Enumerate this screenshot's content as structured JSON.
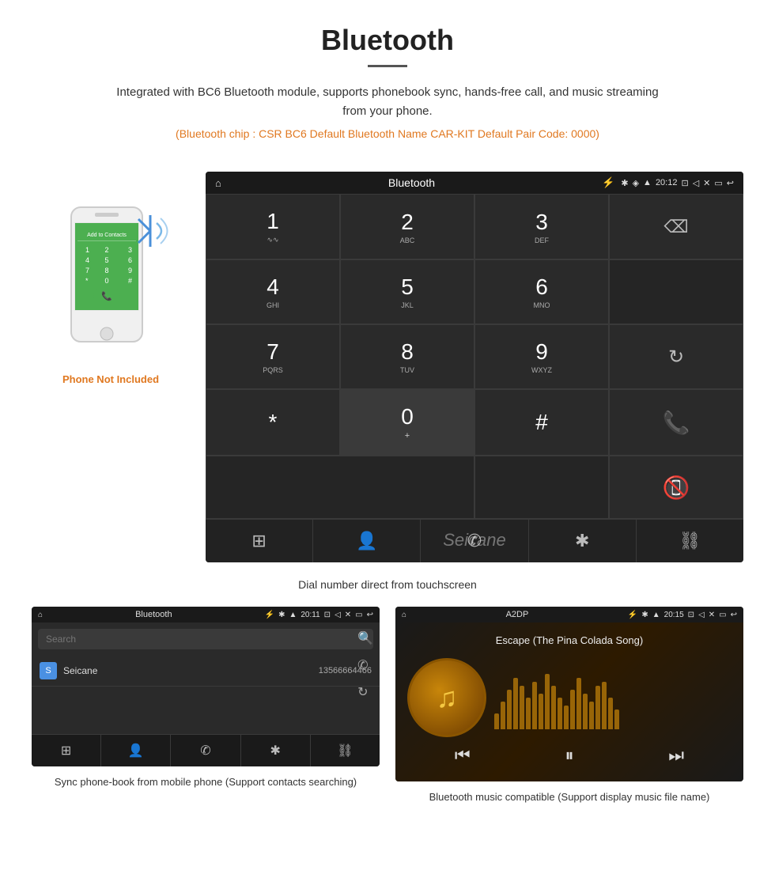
{
  "header": {
    "title": "Bluetooth",
    "description": "Integrated with BC6 Bluetooth module, supports phonebook sync, hands-free call, and music streaming from your phone.",
    "specs": "(Bluetooth chip : CSR BC6    Default Bluetooth Name CAR-KIT    Default Pair Code: 0000)"
  },
  "main_screen": {
    "status_bar": {
      "home_icon": "⌂",
      "title": "Bluetooth",
      "usb_icon": "⚡",
      "bt_icon": "✱",
      "location_icon": "◈",
      "signal_icon": "▲",
      "time": "20:12",
      "camera_icon": "⊡",
      "volume_icon": "◁",
      "close_icon": "✕",
      "window_icon": "▭",
      "back_icon": "↩"
    },
    "dialpad": [
      {
        "digit": "1",
        "sub": "∿∿",
        "type": "normal"
      },
      {
        "digit": "2",
        "sub": "ABC",
        "type": "normal"
      },
      {
        "digit": "3",
        "sub": "DEF",
        "type": "normal"
      },
      {
        "digit": "⌫",
        "sub": "",
        "type": "backspace"
      },
      {
        "digit": "4",
        "sub": "GHI",
        "type": "normal"
      },
      {
        "digit": "5",
        "sub": "JKL",
        "type": "normal"
      },
      {
        "digit": "6",
        "sub": "MNO",
        "type": "normal"
      },
      {
        "digit": "",
        "sub": "",
        "type": "empty"
      },
      {
        "digit": "7",
        "sub": "PQRS",
        "type": "normal"
      },
      {
        "digit": "8",
        "sub": "TUV",
        "type": "normal"
      },
      {
        "digit": "9",
        "sub": "WXYZ",
        "type": "normal"
      },
      {
        "digit": "↻",
        "sub": "",
        "type": "refresh"
      },
      {
        "digit": "*",
        "sub": "",
        "type": "normal"
      },
      {
        "digit": "0",
        "sub": "+",
        "type": "normal"
      },
      {
        "digit": "#",
        "sub": "",
        "type": "normal"
      },
      {
        "digit": "✆",
        "sub": "",
        "type": "call-green"
      },
      {
        "digit": "",
        "sub": "",
        "type": "empty"
      },
      {
        "digit": "✆",
        "sub": "",
        "type": "call-red"
      }
    ],
    "bottom_nav": [
      "⊞",
      "👤",
      "✆",
      "✱",
      "⛓"
    ]
  },
  "dial_caption": "Dial number direct from touchscreen",
  "phone_not_included": "Phone Not Included",
  "phonebook_screen": {
    "status_bar": {
      "home_icon": "⌂",
      "title": "Bluetooth",
      "usb_icon": "⚡",
      "bt_icon": "✱",
      "signal_icon": "▲",
      "time": "20:11",
      "camera_icon": "⊡",
      "volume_icon": "◁",
      "close_icon": "✕",
      "window_icon": "▭",
      "back_icon": "↩"
    },
    "search_placeholder": "Search",
    "contacts": [
      {
        "initial": "S",
        "name": "Seicane",
        "number": "13566664466"
      }
    ],
    "side_icons": [
      "🔍",
      "✆",
      "↻"
    ],
    "bottom_nav": [
      "⊞",
      "👤",
      "✆",
      "✱",
      "⛓"
    ],
    "active_nav": 1
  },
  "phonebook_caption": "Sync phone-book from mobile phone\n(Support contacts searching)",
  "music_screen": {
    "status_bar": {
      "home_icon": "⌂",
      "title": "A2DP",
      "usb_icon": "⚡",
      "bt_icon": "✱",
      "signal_icon": "▲",
      "time": "20:15",
      "camera_icon": "⊡",
      "volume_icon": "◁",
      "close_icon": "✕",
      "window_icon": "▭",
      "back_icon": "↩"
    },
    "song_title": "Escape (The Pina Colada Song)",
    "controls": [
      "⏮",
      "⏯",
      "⏭"
    ],
    "eq_heights": [
      20,
      35,
      50,
      65,
      55,
      40,
      60,
      45,
      70,
      55,
      40,
      30,
      50,
      65,
      45,
      35,
      55,
      60,
      40,
      25
    ]
  },
  "music_caption": "Bluetooth music compatible\n(Support display music file name)"
}
